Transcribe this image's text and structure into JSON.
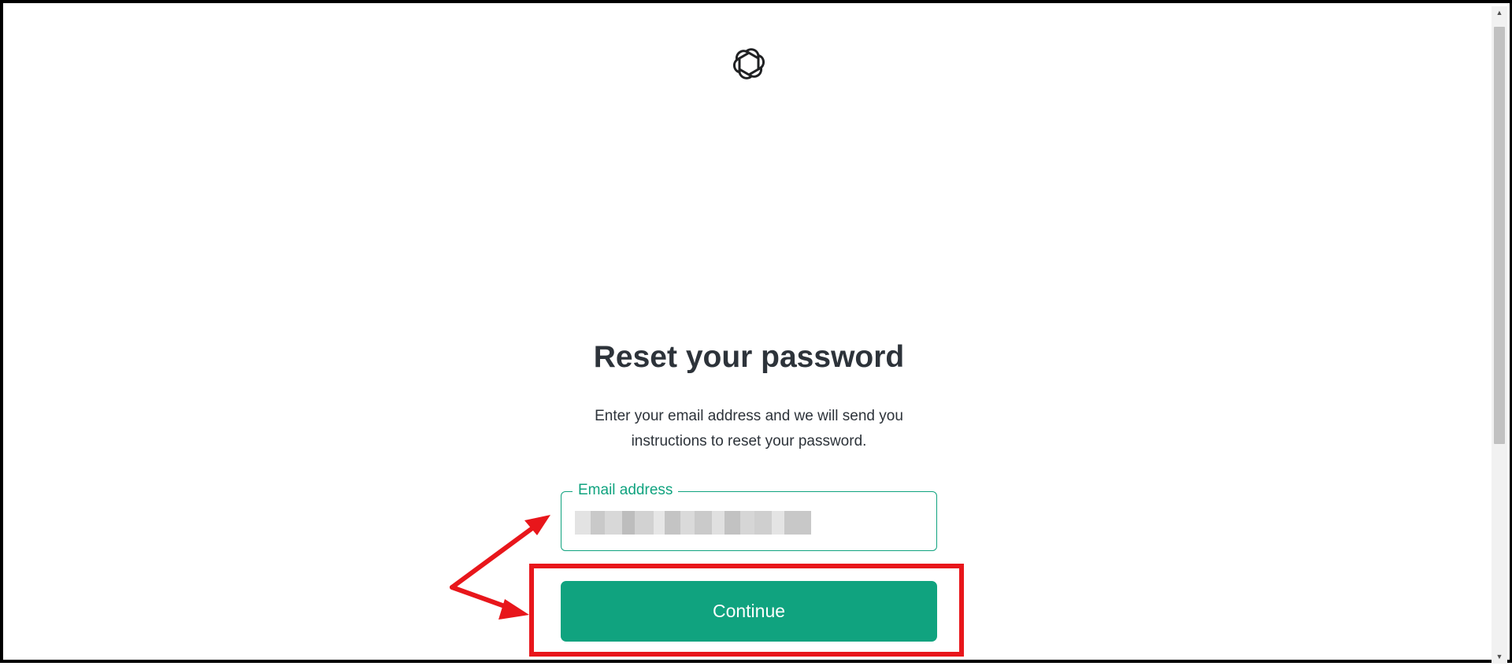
{
  "page": {
    "logo_icon": "openai-logo-icon",
    "title": "Reset your password",
    "subtitle": "Enter your email address and we will send you instructions to reset your password."
  },
  "form": {
    "email_label": "Email address",
    "email_value_state": "redacted",
    "continue_label": "Continue"
  },
  "annotations": {
    "highlight_target": "continue-button",
    "arrow_targets": [
      "email-field",
      "continue-button"
    ],
    "color": "#e8161b"
  },
  "colors": {
    "accent": "#10a37f",
    "text": "#2d333a",
    "annotation": "#e8161b"
  }
}
